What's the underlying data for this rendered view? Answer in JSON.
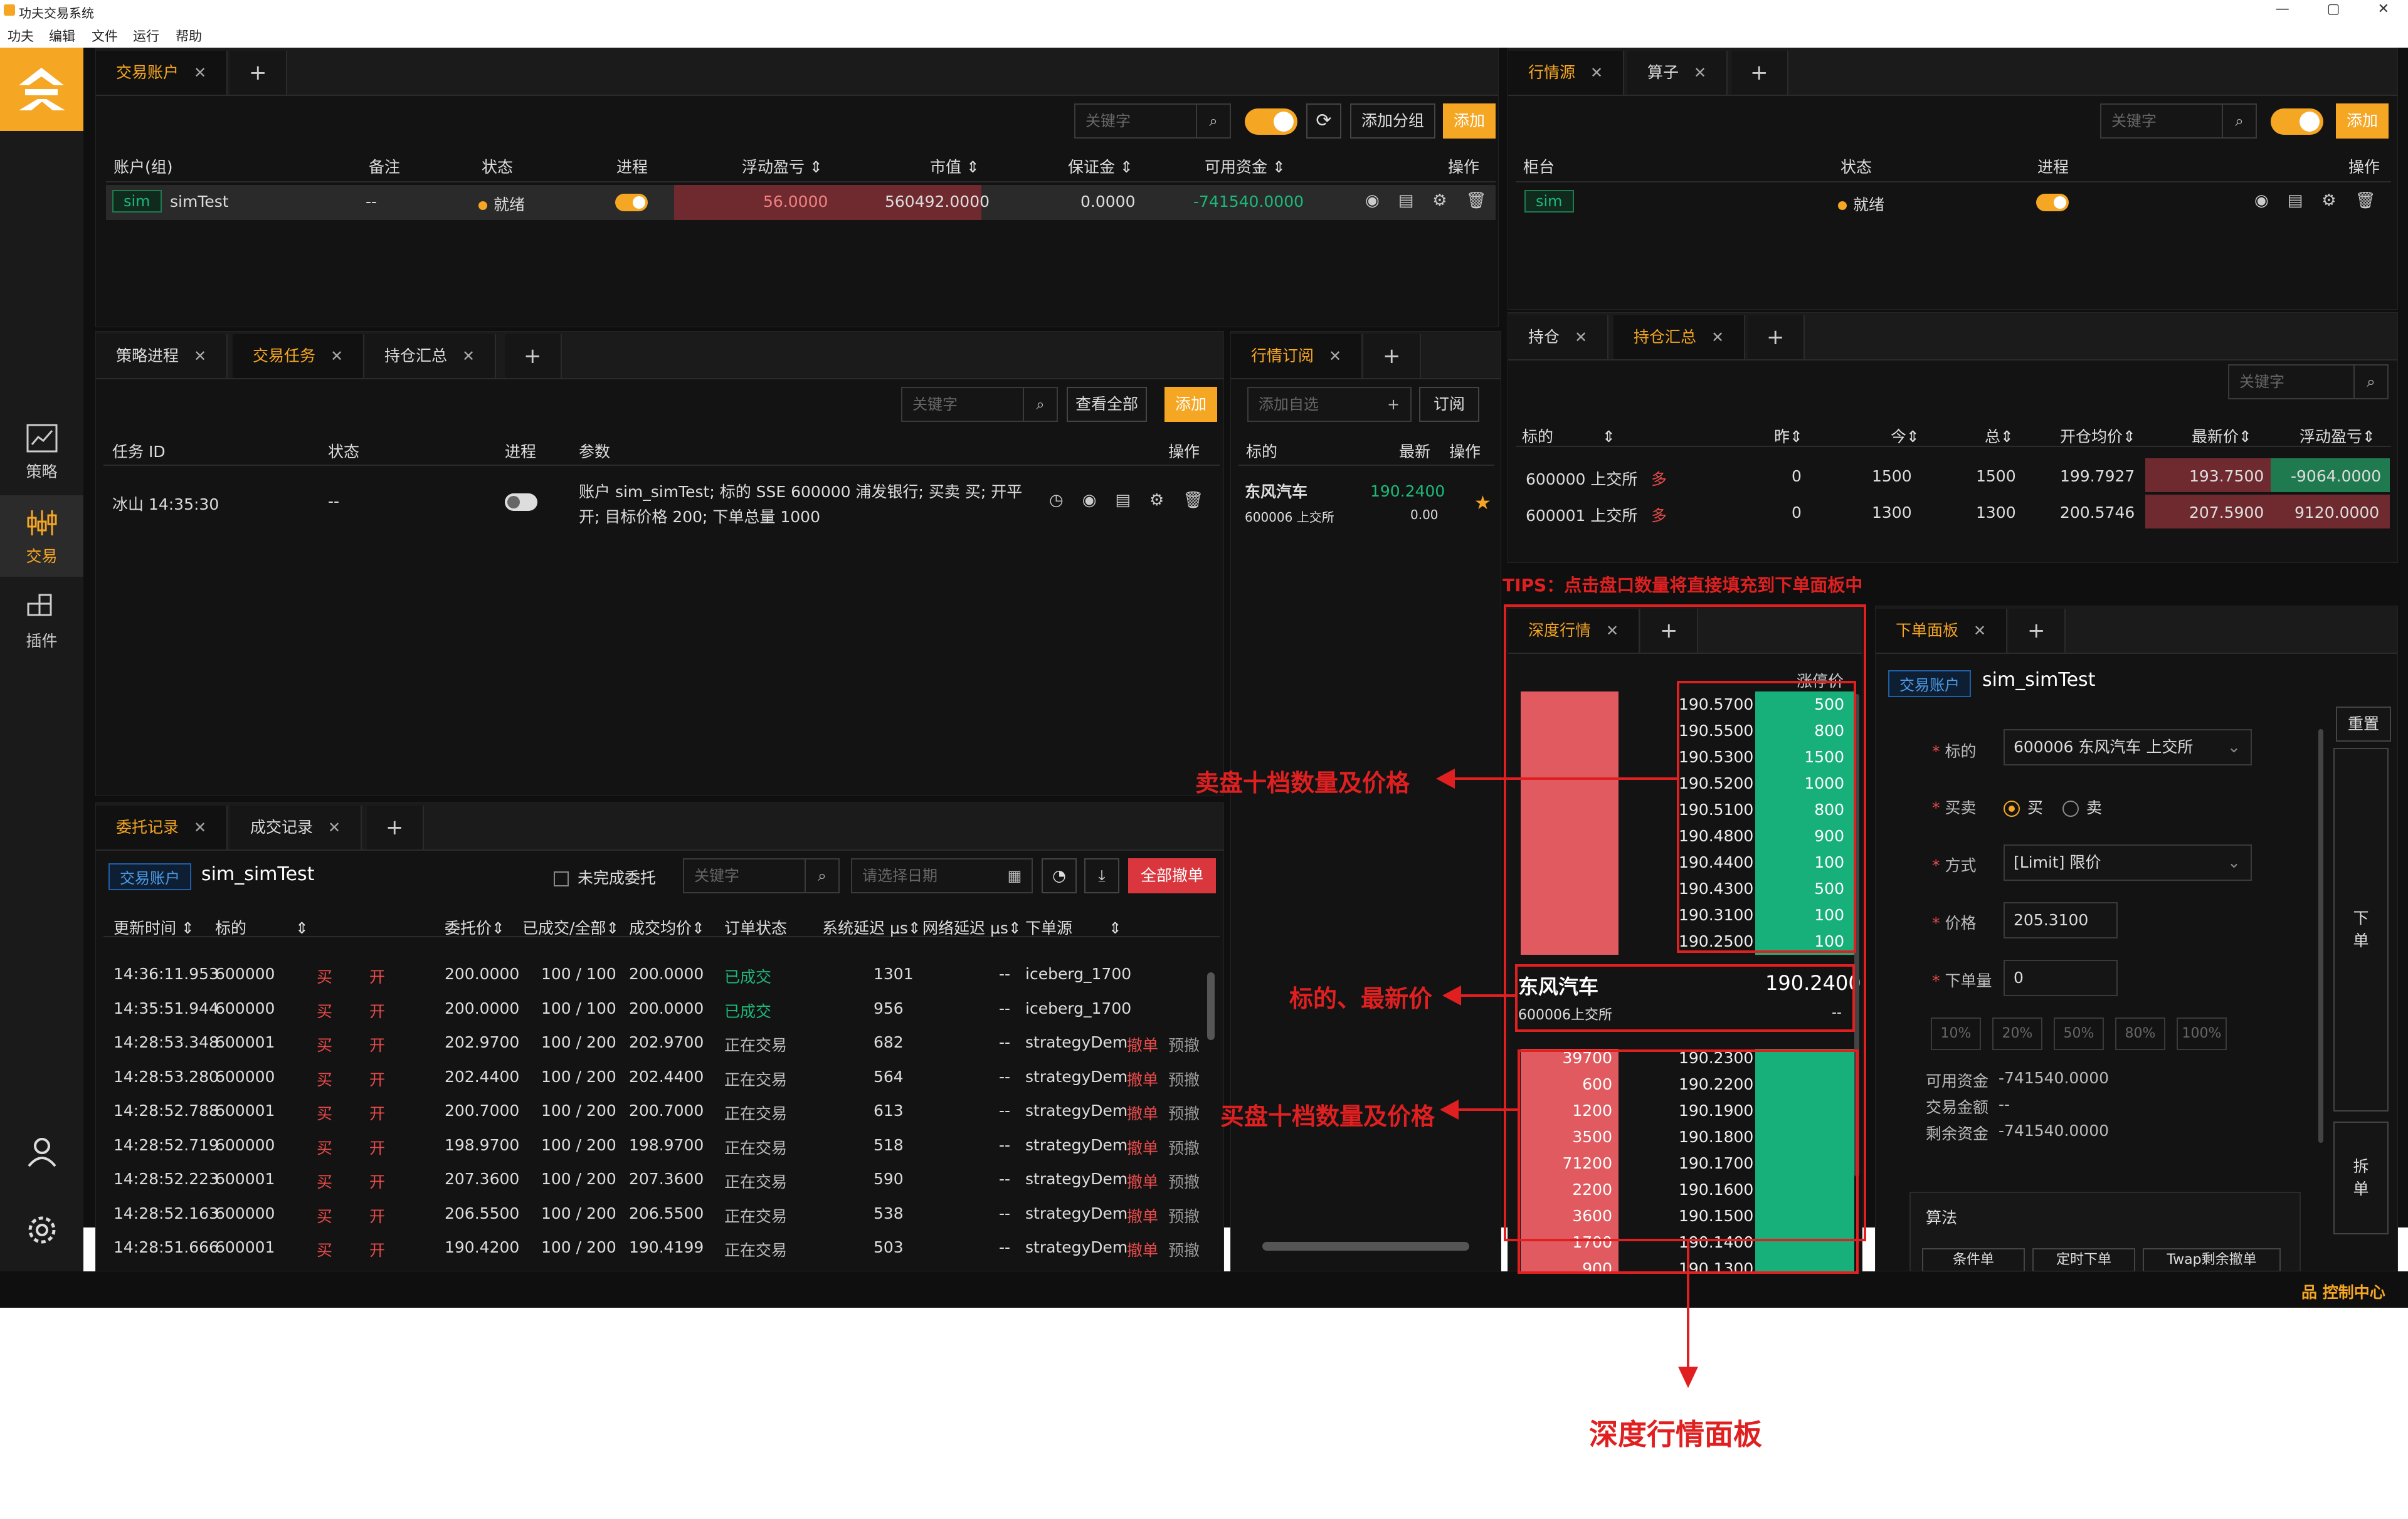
{
  "window": {
    "title": "功夫交易系统"
  },
  "menu": [
    "功夫",
    "编辑",
    "文件",
    "运行",
    "帮助"
  ],
  "sidebar": {
    "items": [
      {
        "label": "策略",
        "icon": "chart-icon"
      },
      {
        "label": "交易",
        "icon": "sliders-icon"
      },
      {
        "label": "插件",
        "icon": "plugin-icon"
      }
    ],
    "bottom": [
      "user-icon",
      "gear-icon"
    ]
  },
  "account_panel": {
    "tab": "交易账户",
    "search_placeholder": "关键字",
    "add_group": "添加分组",
    "add": "添加",
    "headers": [
      "账户(组)",
      "备注",
      "状态",
      "进程",
      "浮动盈亏",
      "市值",
      "保证金",
      "可用资金",
      "操作"
    ],
    "row": {
      "badge": "sim",
      "name": "simTest",
      "note": "--",
      "status": "就绪",
      "pnl": "56.0000",
      "market_value": "560492.0000",
      "margin": "0.0000",
      "available": "-741540.0000"
    }
  },
  "source_panel": {
    "tabs": [
      "行情源",
      "算子"
    ],
    "search_placeholder": "关键字",
    "add": "添加",
    "headers": [
      "柜台",
      "状态",
      "进程",
      "操作"
    ],
    "row": {
      "badge": "sim",
      "status": "就绪"
    }
  },
  "task_panel": {
    "tabs": [
      "策略进程",
      "交易任务",
      "持仓汇总"
    ],
    "search_placeholder": "关键字",
    "view_all": "查看全部",
    "add": "添加",
    "headers": [
      "任务 ID",
      "状态",
      "进程",
      "参数",
      "操作"
    ],
    "row": {
      "id": "冰山 14:35:30",
      "status": "--",
      "params_1": "账户 sim_simTest; 标的 SSE 600000 浦发银行; 买卖 买; 开平",
      "params_2": "开; 目标价格 200; 下单总量 1000"
    }
  },
  "sub_panel": {
    "tab": "行情订阅",
    "placeholder": "添加自选",
    "subscribe": "订阅",
    "headers": [
      "标的",
      "最新",
      "操作"
    ],
    "row": {
      "name": "东风汽车",
      "code": "600006 上交所",
      "price": "190.2400",
      "change": "0.00"
    }
  },
  "position_panel": {
    "tabs": [
      "持仓",
      "持仓汇总"
    ],
    "search_placeholder": "关键字",
    "headers": [
      "标的",
      "昨",
      "今",
      "总",
      "开仓均价",
      "最新价",
      "浮动盈亏"
    ],
    "rows": [
      {
        "symbol": "600000 上交所",
        "dir": "多",
        "yd": "0",
        "today": "1500",
        "total": "1500",
        "avg": "199.7927",
        "last": "193.7500",
        "pnl": "-9064.0000"
      },
      {
        "symbol": "600001 上交所",
        "dir": "多",
        "yd": "0",
        "today": "1300",
        "total": "1300",
        "avg": "200.5746",
        "last": "207.5900",
        "pnl": "9120.0000"
      }
    ]
  },
  "order_panel": {
    "tabs": [
      "委托记录",
      "成交记录"
    ],
    "account_badge": "交易账户",
    "account": "sim_simTest",
    "unfinished": "未完成委托",
    "search_placeholder": "关键字",
    "date_placeholder": "请选择日期",
    "cancel_all": "全部撤单",
    "headers": [
      "更新时间",
      "标的",
      "",
      "",
      "委托价",
      "已成交/全部",
      "成交均价",
      "订单状态",
      "系统延迟 μs",
      "网络延迟 μs",
      "下单源"
    ],
    "rows": [
      {
        "time": "14:36:11.953",
        "symbol": "600000",
        "side": "买",
        "offset": "开",
        "price": "200.0000",
        "filled": "100 / 100",
        "avg": "200.0000",
        "status": "已成交",
        "sys": "1301",
        "net": "--",
        "source": "iceberg_1700",
        "actions": false
      },
      {
        "time": "14:35:51.944",
        "symbol": "600000",
        "side": "买",
        "offset": "开",
        "price": "200.0000",
        "filled": "100 / 100",
        "avg": "200.0000",
        "status": "已成交",
        "sys": "956",
        "net": "--",
        "source": "iceberg_1700",
        "actions": false
      },
      {
        "time": "14:28:53.348",
        "symbol": "600001",
        "side": "买",
        "offset": "开",
        "price": "202.9700",
        "filled": "100 / 200",
        "avg": "202.9700",
        "status": "正在交易",
        "sys": "682",
        "net": "--",
        "source": "strategyDem",
        "actions": true
      },
      {
        "time": "14:28:53.280",
        "symbol": "600000",
        "side": "买",
        "offset": "开",
        "price": "202.4400",
        "filled": "100 / 200",
        "avg": "202.4400",
        "status": "正在交易",
        "sys": "564",
        "net": "--",
        "source": "strategyDem",
        "actions": true
      },
      {
        "time": "14:28:52.788",
        "symbol": "600001",
        "side": "买",
        "offset": "开",
        "price": "200.7000",
        "filled": "100 / 200",
        "avg": "200.7000",
        "status": "正在交易",
        "sys": "613",
        "net": "--",
        "source": "strategyDem",
        "actions": true
      },
      {
        "time": "14:28:52.719",
        "symbol": "600000",
        "side": "买",
        "offset": "开",
        "price": "198.9700",
        "filled": "100 / 200",
        "avg": "198.9700",
        "status": "正在交易",
        "sys": "518",
        "net": "--",
        "source": "strategyDem",
        "actions": true
      },
      {
        "time": "14:28:52.223",
        "symbol": "600001",
        "side": "买",
        "offset": "开",
        "price": "207.3600",
        "filled": "100 / 200",
        "avg": "207.3600",
        "status": "正在交易",
        "sys": "590",
        "net": "--",
        "source": "strategyDem",
        "actions": true
      },
      {
        "time": "14:28:52.163",
        "symbol": "600000",
        "side": "买",
        "offset": "开",
        "price": "206.5500",
        "filled": "100 / 200",
        "avg": "206.5500",
        "status": "正在交易",
        "sys": "538",
        "net": "--",
        "source": "strategyDem",
        "actions": true
      },
      {
        "time": "14:28:51.666",
        "symbol": "600001",
        "side": "买",
        "offset": "开",
        "price": "190.4200",
        "filled": "100 / 200",
        "avg": "190.4199",
        "status": "正在交易",
        "sys": "503",
        "net": "--",
        "source": "strategyDem",
        "actions": true
      }
    ],
    "cancel": "撤单",
    "preview": "预撤"
  },
  "depth_panel": {
    "tab": "深度行情",
    "header_left": "--",
    "header_right": "涨停价",
    "asks": [
      {
        "p": "190.5700",
        "v": "500"
      },
      {
        "p": "190.5500",
        "v": "800"
      },
      {
        "p": "190.5300",
        "v": "1500"
      },
      {
        "p": "190.5200",
        "v": "1000"
      },
      {
        "p": "190.5100",
        "v": "800"
      },
      {
        "p": "190.4800",
        "v": "900"
      },
      {
        "p": "190.4400",
        "v": "100"
      },
      {
        "p": "190.4300",
        "v": "500"
      },
      {
        "p": "190.3100",
        "v": "100"
      },
      {
        "p": "190.2500",
        "v": "100"
      }
    ],
    "mid": {
      "name": "东风汽车",
      "price": "190.2400",
      "code": "600006上交所",
      "sub": "--"
    },
    "bids": [
      {
        "p": "190.2300",
        "v": "39700"
      },
      {
        "p": "190.2200",
        "v": "600"
      },
      {
        "p": "190.1900",
        "v": "1200"
      },
      {
        "p": "190.1800",
        "v": "3500"
      },
      {
        "p": "190.1700",
        "v": "71200"
      },
      {
        "p": "190.1600",
        "v": "2200"
      },
      {
        "p": "190.1500",
        "v": "3600"
      },
      {
        "p": "190.1400",
        "v": "1700"
      },
      {
        "p": "190.1300",
        "v": "900"
      }
    ]
  },
  "ticket_panel": {
    "tab": "下单面板",
    "account_badge": "交易账户",
    "account": "sim_simTest",
    "reset": "重置",
    "symbol_label": "标的",
    "symbol_value": "600006 东风汽车 上交所",
    "side_label": "买卖",
    "buy": "买",
    "sell": "卖",
    "mode_label": "方式",
    "mode_value": "[Limit] 限价",
    "price_label": "价格",
    "price_value": "205.3100",
    "qty_label": "下单量",
    "qty_value": "0",
    "pcts": [
      "10%",
      "20%",
      "50%",
      "80%",
      "100%"
    ],
    "available_label": "可用资金",
    "available_value": "-741540.0000",
    "amount_label": "交易金额",
    "amount_value": "--",
    "remain_label": "剩余资金",
    "remain_value": "-741540.0000",
    "algo_label": "算法",
    "algo_tabs": [
      "条件单",
      "定时下单",
      "Twap剩余撤单"
    ],
    "place_order": "下单",
    "split_order": "拆单"
  },
  "statusbar": {
    "control": "控制中心"
  },
  "annotations": {
    "tips": "TIPS：点击盘口数量将直接填充到下单面板中",
    "ask": "卖盘十档数量及价格",
    "mid": "标的、最新价",
    "bid": "买盘十档数量及价格",
    "panel": "深度行情面板"
  },
  "colors": {
    "accent": "#f5a623",
    "up": "#e84a4a",
    "down": "#1db87a",
    "annotation": "#e02020"
  }
}
